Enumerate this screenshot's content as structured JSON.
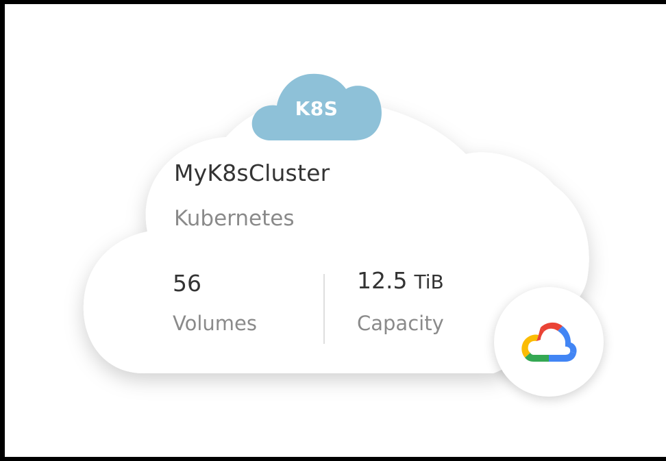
{
  "cluster": {
    "badge": "K8S",
    "name": "MyK8sCluster",
    "type": "Kubernetes"
  },
  "stats": {
    "volumes": {
      "value": "56",
      "label": "Volumes"
    },
    "capacity": {
      "value": "12.5",
      "unit": "TiB",
      "label": "Capacity"
    }
  },
  "provider": {
    "icon": "google-cloud-icon"
  },
  "colors": {
    "badge": "#8ec1d8",
    "card": "#ffffff",
    "google_red": "#ea4335",
    "google_yellow": "#fbbc04",
    "google_green": "#34a853",
    "google_blue": "#4285f4"
  }
}
